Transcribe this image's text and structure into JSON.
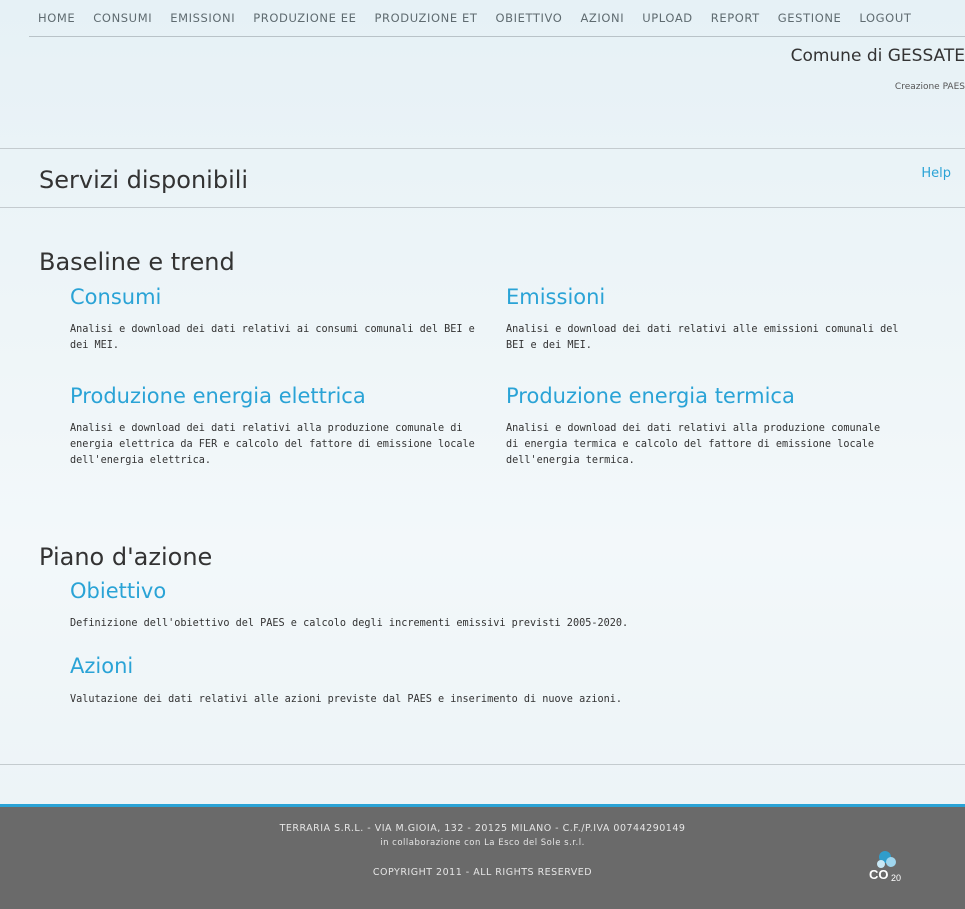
{
  "nav": {
    "items": [
      "HOME",
      "CONSUMI",
      "EMISSIONI",
      "PRODUZIONE EE",
      "PRODUZIONE ET",
      "OBIETTIVO",
      "AZIONI",
      "UPLOAD",
      "REPORT",
      "GESTIONE",
      "LOGOUT"
    ]
  },
  "header": {
    "comune": "Comune di GESSATE",
    "subtitle": "Creazione PAES"
  },
  "page": {
    "title": "Servizi disponibili",
    "help": "Help"
  },
  "sections": {
    "baseline": {
      "title": "Baseline e trend",
      "consumi_title": "Consumi",
      "consumi_desc": "Analisi e download dei dati relativi ai consumi comunali del BEI e dei MEI.",
      "emissioni_title": "Emissioni",
      "emissioni_desc": "Analisi e download dei dati relativi alle emissioni comunali del BEI e dei MEI.",
      "ee_title": "Produzione energia elettrica",
      "ee_desc": "Analisi e download dei dati relativi alla produzione comunale di energia elettrica da FER e calcolo del fattore di emissione locale dell'energia elettrica.",
      "et_title": "Produzione energia termica",
      "et_desc": "Analisi e download dei dati relativi alla produzione comunale di energia termica e calcolo del fattore di emissione locale dell'energia termica."
    },
    "piano": {
      "title": "Piano d'azione",
      "obiettivo_title": "Obiettivo",
      "obiettivo_desc": "Definizione dell'obiettivo del PAES e calcolo degli incrementi emissivi previsti 2005-2020.",
      "azioni_title": "Azioni",
      "azioni_desc": "Valutazione dei dati relativi alle azioni previste dal PAES e inserimento di nuove azioni."
    }
  },
  "footer": {
    "line1": "TERRARIA S.R.L. - VIA M.GIOIA, 132 - 20125 MILANO - C.F./P.IVA 00744290149",
    "line2": "in collaborazione con La Esco del Sole s.r.l.",
    "line3": "COPYRIGHT 2011 - ALL RIGHTS RESERVED",
    "logo_text": "CO20"
  },
  "colors": {
    "accent": "#2aa3d6",
    "footer_bg": "#6a6a6a"
  }
}
